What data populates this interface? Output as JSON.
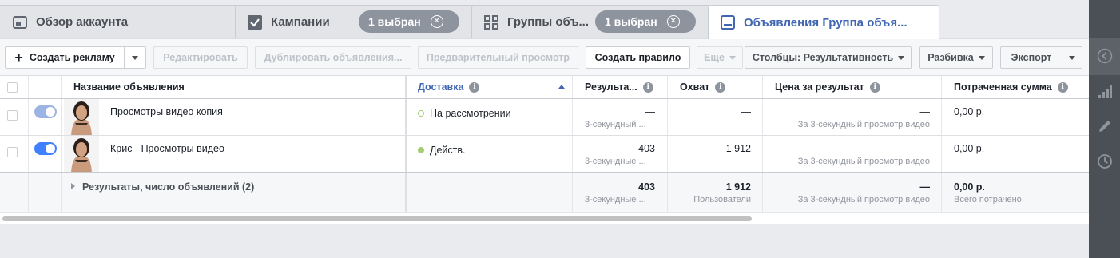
{
  "tabs": {
    "overview": "Обзор аккаунта",
    "campaigns": "Кампании",
    "campaigns_selected": "1 выбран",
    "adsets": "Группы объ...",
    "adsets_selected": "1 выбран",
    "ads": "Объявления Группа объя..."
  },
  "toolbar": {
    "create": "Создать рекламу",
    "edit": "Редактировать",
    "duplicate": "Дублировать объявления...",
    "preview": "Предварительный просмотр",
    "create_rule": "Создать правило",
    "more": "Еще",
    "columns": "Столбцы: Результативность",
    "breakdown": "Разбивка",
    "export": "Экспорт"
  },
  "table": {
    "headers": {
      "name": "Название объявления",
      "delivery": "Доставка",
      "results": "Результа...",
      "reach": "Охват",
      "cost": "Цена за результат",
      "spent": "Потраченная сумма"
    },
    "rows": [
      {
        "name": "Просмотры видео копия",
        "delivery": "На рассмотрении",
        "results": "—",
        "results_sub": "3-секундный ...",
        "reach": "—",
        "cost": "—",
        "cost_sub": "За 3-секундный просмотр видео",
        "spent": "0,00 р."
      },
      {
        "name": "Крис - Просмотры видео",
        "delivery": "Действ.",
        "results": "403",
        "results_sub": "3-секундные ...",
        "reach": "1 912",
        "cost": "—",
        "cost_sub": "За 3-секундный просмотр видео",
        "spent": "0,00 р."
      }
    ],
    "summary": {
      "label": "Результаты, число объявлений (2)",
      "results": "403",
      "results_sub": "3-секундные ...",
      "reach": "1 912",
      "reach_sub": "Пользователи",
      "cost": "—",
      "cost_sub": "За 3-секундный просмотр видео",
      "spent": "0,00 р.",
      "spent_sub": "Всего потрачено"
    }
  },
  "colors": {
    "accent": "#4267b2",
    "toggle_on": "#4080ff",
    "toggle_pending": "#9cb4e4",
    "status_active": "#a3ce71",
    "panel": "#4b4f56"
  }
}
